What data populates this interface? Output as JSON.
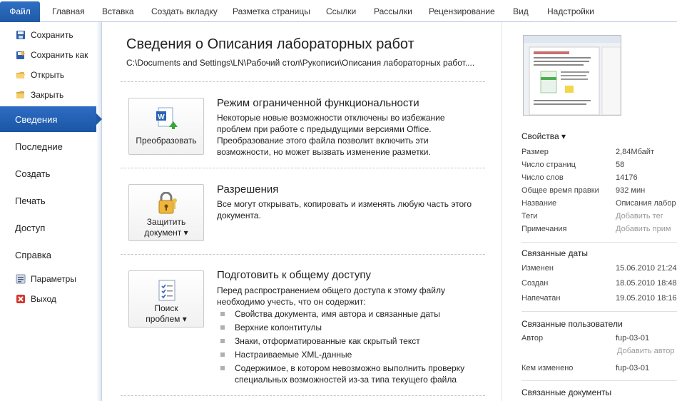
{
  "tabs": {
    "file": "Файл",
    "items": [
      "Главная",
      "Вставка",
      "Создать вкладку",
      "Разметка страницы",
      "Ссылки",
      "Рассылки",
      "Рецензирование",
      "Вид",
      "Надстройки"
    ]
  },
  "nav": {
    "save": "Сохранить",
    "save_as": "Сохранить как",
    "open": "Открыть",
    "close": "Закрыть",
    "info": "Сведения",
    "recent": "Последние",
    "new": "Создать",
    "print": "Печать",
    "share": "Доступ",
    "help": "Справка",
    "options": "Параметры",
    "exit": "Выход"
  },
  "main": {
    "title": "Сведения о Описания лабораторных работ",
    "path": "C:\\Documents and Settings\\LN\\Рабочий стол\\Рукописи\\Описания лабораторных работ....",
    "compat": {
      "button": "Преобразовать",
      "heading": "Режим ограниченной функциональности",
      "text": "Некоторые новые возможности отключены во избежание проблем при работе с предыдущими версиями Office. Преобразование этого файла позволит включить эти возможности, но может вызвать изменение разметки."
    },
    "perm": {
      "button_line1": "Защитить",
      "button_line2": "документ ▾",
      "heading": "Разрешения",
      "text": "Все могут открывать, копировать и изменять любую часть этого документа."
    },
    "prepare": {
      "button_line1": "Поиск",
      "button_line2": "проблем ▾",
      "heading": "Подготовить к общему доступу",
      "text": "Перед распространением общего доступа к этому файлу необходимо учесть, что он содержит:",
      "bullets": [
        "Свойства документа, имя автора и связанные даты",
        "Верхние колонтитулы",
        "Знаки, отформатированные как скрытый текст",
        "Настраиваемые XML-данные",
        "Содержимое, в котором невозможно выполнить проверку специальных возможностей из-за типа текущего файла"
      ]
    }
  },
  "props": {
    "heading": "Свойства ▾",
    "rows": [
      {
        "k": "Размер",
        "v": "2,84Мбайт"
      },
      {
        "k": "Число страниц",
        "v": "58"
      },
      {
        "k": "Число слов",
        "v": "14176"
      },
      {
        "k": "Общее время правки",
        "v": "932 мин"
      },
      {
        "k": "Название",
        "v": "Описания лабор"
      },
      {
        "k": "Теги",
        "v": "Добавить тег"
      },
      {
        "k": "Примечания",
        "v": "Добавить прим"
      }
    ],
    "dates_heading": "Связанные даты",
    "dates": [
      {
        "k": "Изменен",
        "v": "15.06.2010 21:24"
      },
      {
        "k": "Создан",
        "v": "18.05.2010 18:48"
      },
      {
        "k": "Напечатан",
        "v": "19.05.2010 18:16"
      }
    ],
    "people_heading": "Связанные пользователи",
    "author_k": "Автор",
    "author_v": "fup-03-01",
    "add_author": "Добавить автор",
    "modified_by_k": "Кем изменено",
    "modified_by_v": "fup-03-01",
    "docs_heading": "Связанные документы"
  }
}
